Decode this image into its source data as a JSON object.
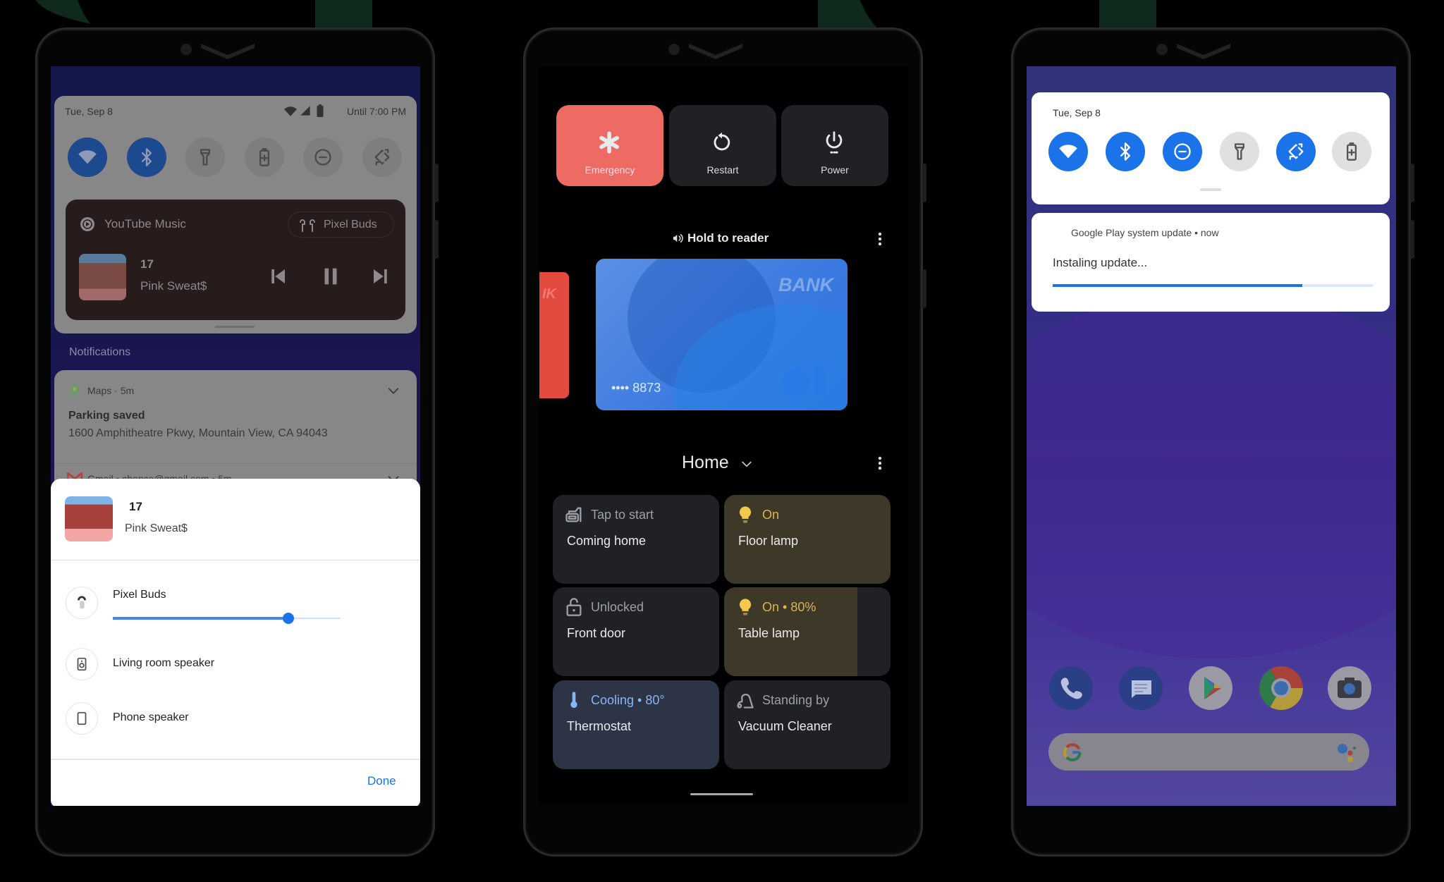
{
  "colors": {
    "accent_blue": "#1a73e8",
    "emergency_red": "#ee6b63",
    "lamp_yellow": "#f2c94c",
    "thermo_blue": "#8ab4f8",
    "decor_green": "#0f2a1c"
  },
  "left_phone": {
    "status_date": "Tue, Sep 8",
    "status_right": "Until 7:00 PM",
    "quick_tiles": [
      {
        "icon": "wifi-icon",
        "active": true
      },
      {
        "icon": "bluetooth-icon",
        "active": true
      },
      {
        "icon": "flashlight-icon",
        "active": false
      },
      {
        "icon": "battery-saver-icon",
        "active": false
      },
      {
        "icon": "dnd-icon",
        "active": false
      },
      {
        "icon": "auto-rotate-icon",
        "active": false
      }
    ],
    "media": {
      "app": "YouTube Music",
      "output_chip": "Pixel Buds",
      "title": "17",
      "artist": "Pink Sweat$"
    },
    "notifications_header": "Notifications",
    "notifications": [
      {
        "app": "Maps",
        "time": "5m",
        "title": "Parking saved",
        "body": "1600 Amphitheatre Pkwy, Mountain View, CA 94043"
      },
      {
        "app": "Gmail",
        "account": "chance@gmail.com",
        "time": "5m"
      }
    ],
    "output_sheet": {
      "title": "17",
      "artist": "Pink Sweat$",
      "devices": [
        {
          "label": "Pixel Buds",
          "icon": "pixel-buds-icon",
          "selected": true
        },
        {
          "label": "Living room speaker",
          "icon": "speaker-icon"
        },
        {
          "label": "Phone speaker",
          "icon": "phone-speaker-icon"
        }
      ],
      "volume_fraction": 0.77,
      "done_label": "Done"
    }
  },
  "middle_phone": {
    "power_menu": [
      {
        "label": "Emergency",
        "icon": "asterisk-icon"
      },
      {
        "label": "Restart",
        "icon": "restart-icon"
      },
      {
        "label": "Power",
        "icon": "power-icon"
      }
    ],
    "wallet": {
      "hint": "Hold to reader",
      "card_brand": "BANK",
      "card_number": "•••• 8873",
      "partial_card_label": "IK"
    },
    "controls": {
      "structure": "Home",
      "tiles": [
        {
          "status": "Tap to start",
          "name": "Coming home",
          "icon": "routine-icon",
          "state": "idle"
        },
        {
          "status": "On",
          "name": "Floor lamp",
          "icon": "bulb-icon",
          "state": "on"
        },
        {
          "status": "Unlocked",
          "name": "Front door",
          "icon": "lock-open-icon",
          "state": "idle"
        },
        {
          "status": "On • 80%",
          "name": "Table lamp",
          "icon": "bulb-icon",
          "state": "on",
          "level": 0.8
        },
        {
          "status": "Cooling • 80°",
          "name": "Thermostat",
          "icon": "thermometer-icon",
          "state": "cooling"
        },
        {
          "status": "Standing by",
          "name": "Vacuum Cleaner",
          "icon": "vacuum-icon",
          "state": "idle"
        }
      ]
    }
  },
  "right_phone": {
    "status_date": "Tue, Sep 8",
    "quick_tiles": [
      {
        "icon": "wifi-icon",
        "active": true
      },
      {
        "icon": "bluetooth-icon",
        "active": true
      },
      {
        "icon": "dnd-icon",
        "active": true
      },
      {
        "icon": "flashlight-icon",
        "active": false
      },
      {
        "icon": "auto-rotate-icon",
        "active": true
      },
      {
        "icon": "battery-saver-icon",
        "active": false
      }
    ],
    "notification": {
      "header": "Google Play system update • now",
      "body": "Instaling update...",
      "progress": 0.78
    },
    "dock": [
      "phone-app-icon",
      "messages-icon",
      "play-store-icon",
      "chrome-icon",
      "camera-icon"
    ]
  }
}
